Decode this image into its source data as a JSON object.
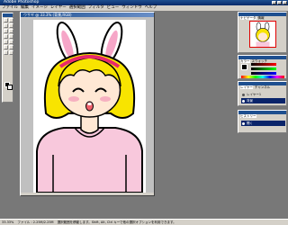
{
  "window": {
    "title": "Adobe Photoshop"
  },
  "menubar": {
    "items": [
      "ファイル",
      "編集",
      "イメージ",
      "レイヤー",
      "選択範囲",
      "フィルタ",
      "ビュー",
      "ウィンドウ",
      "ヘルプ"
    ]
  },
  "document": {
    "title": "ウサギ @ 33.3% (背景,RGB)"
  },
  "navigator": {
    "tabs": [
      "ナビゲータ",
      "情報"
    ]
  },
  "color_palette": {
    "tabs": [
      "カラー",
      "スウォッチ"
    ]
  },
  "layers_palette": {
    "tabs": [
      "レイヤー",
      "チャンネル"
    ],
    "rows": [
      {
        "name": "レイヤー1"
      },
      {
        "name": "背景"
      }
    ]
  },
  "layers_palette_2": {
    "tabs": [
      "ヒストリー"
    ],
    "rows": [
      {
        "name": "開く"
      }
    ]
  },
  "statusbar": {
    "zoom": "33.33%",
    "doc_size": "ファイル : 2.25M/2.25M",
    "hint": "選択範囲を移動します。Shift, Alt, Ctrl キーで他の選択オプションを利用できます。"
  },
  "colors": {
    "workspace": "#787878",
    "panel": "#d4d0c8",
    "titlebar": "#1e4f8f",
    "hair": "#f8e400",
    "skin": "#ffe8d4",
    "shirt": "#f8c8dc",
    "ear_inner": "#f6a6c8",
    "headband": "#e8286a"
  }
}
